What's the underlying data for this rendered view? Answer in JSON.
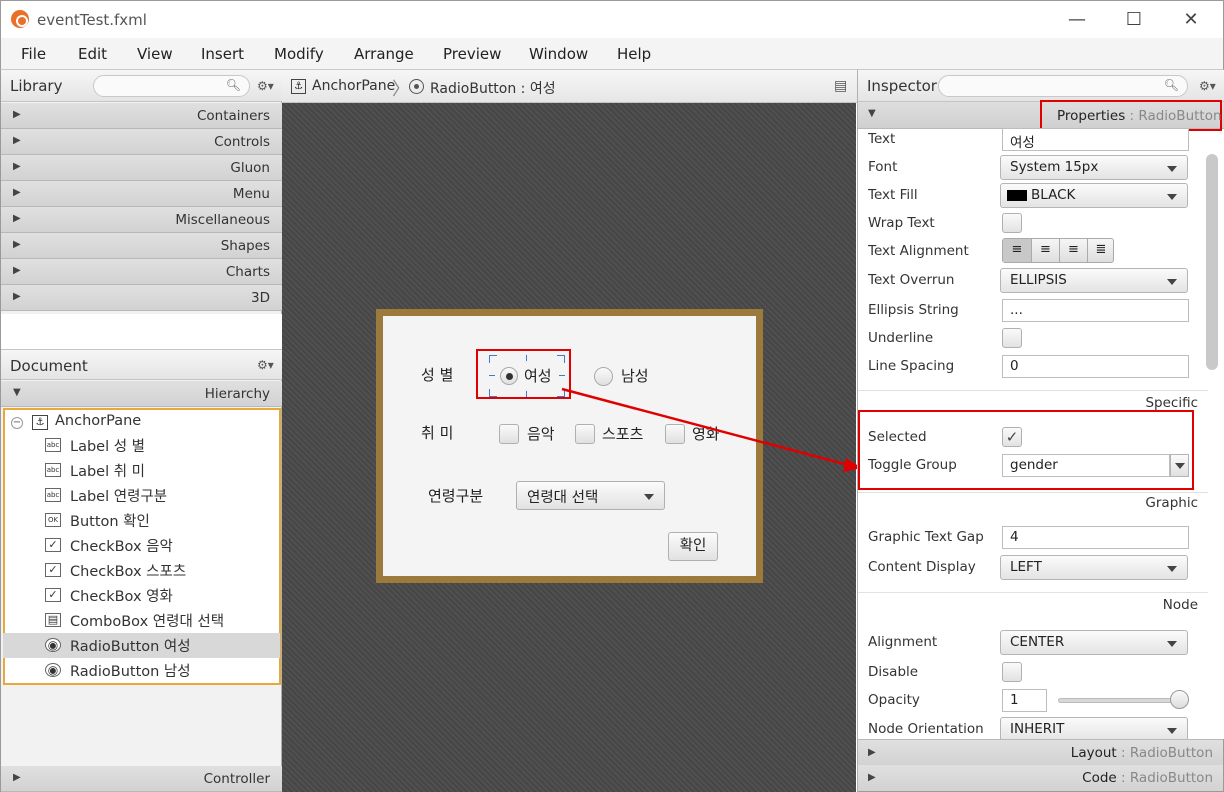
{
  "window": {
    "title": "eventTest.fxml",
    "minimize": "—",
    "maximize": "☐",
    "close": "✕"
  },
  "menus": [
    "File",
    "Edit",
    "View",
    "Insert",
    "Modify",
    "Arrange",
    "Preview",
    "Window",
    "Help"
  ],
  "library": {
    "title": "Library",
    "search_icon": "search-icon",
    "categories": [
      "Containers",
      "Controls",
      "Gluon",
      "Menu",
      "Miscellaneous",
      "Shapes",
      "Charts",
      "3D"
    ]
  },
  "document": {
    "title": "Document",
    "hierarchy_label": "Hierarchy",
    "root": "AnchorPane",
    "items": [
      {
        "icon": "abc",
        "text": "Label 성 별"
      },
      {
        "icon": "abc",
        "text": "Label 취 미"
      },
      {
        "icon": "abc",
        "text": "Label 연령구분"
      },
      {
        "icon": "OK",
        "text": "Button 확인"
      },
      {
        "icon": "✓",
        "text": "CheckBox 음악"
      },
      {
        "icon": "✓",
        "text": "CheckBox 스포츠"
      },
      {
        "icon": "✓",
        "text": "CheckBox 영화"
      },
      {
        "icon": "▤",
        "text": "ComboBox 연령대 선택"
      },
      {
        "icon": "◉",
        "text": "RadioButton 여성"
      },
      {
        "icon": "◉",
        "text": "RadioButton 남성"
      }
    ],
    "controller_label": "Controller"
  },
  "breadcrumb": {
    "root": "AnchorPane",
    "current": "RadioButton : 여성"
  },
  "dialog": {
    "gender_label": "성  별",
    "female": "여성",
    "male": "남성",
    "hobby_label": "취  미",
    "hobby_music": "음악",
    "hobby_sports": "스포츠",
    "hobby_movie": "영화",
    "age_label": "연령구분",
    "age_combo": "연령대 선택",
    "confirm": "확인"
  },
  "inspector": {
    "title": "Inspector",
    "properties_header": "Properties",
    "properties_type": "RadioButton",
    "text_label": "Text",
    "text_value": "여성",
    "font_label": "Font",
    "font_value": "System 15px",
    "textfill_label": "Text Fill",
    "textfill_value": "BLACK",
    "wrap_label": "Wrap Text",
    "align_label": "Text Alignment",
    "overrun_label": "Text Overrun",
    "overrun_value": "ELLIPSIS",
    "ellipsis_label": "Ellipsis String",
    "ellipsis_value": "...",
    "underline_label": "Underline",
    "linespacing_label": "Line Spacing",
    "linespacing_value": "0",
    "specific_section": "Specific",
    "selected_label": "Selected",
    "togglegroup_label": "Toggle Group",
    "togglegroup_value": "gender",
    "graphic_section": "Graphic",
    "gap_label": "Graphic Text Gap",
    "gap_value": "4",
    "content_label": "Content Display",
    "content_value": "LEFT",
    "node_section": "Node",
    "alignment_label": "Alignment",
    "alignment_value": "CENTER",
    "disable_label": "Disable",
    "opacity_label": "Opacity",
    "opacity_value": "1",
    "orientation_label": "Node Orientation",
    "orientation_value": "INHERIT",
    "layout_header": "Layout",
    "code_header": "Code",
    "section_type": "RadioButton"
  },
  "colors": {
    "highlight": "#e00000",
    "frame": "#9b7a3c",
    "selection": "#e7a93a"
  }
}
